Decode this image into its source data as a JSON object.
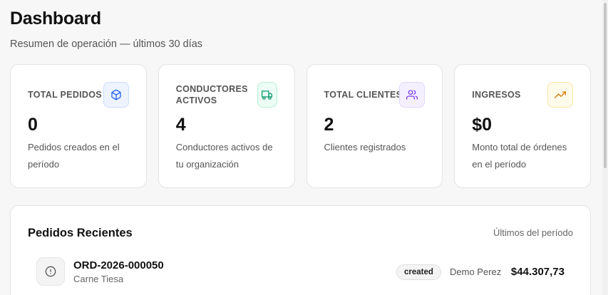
{
  "header": {
    "title": "Dashboard",
    "subtitle": "Resumen de operación — últimos 30 días"
  },
  "stats": [
    {
      "label": "Total pedidos",
      "value": "0",
      "description": "Pedidos creados en el período",
      "icon": "box-icon",
      "color": "#2563eb"
    },
    {
      "label": "Conductores activos",
      "value": "4",
      "description": "Conductores activos de tu organización",
      "icon": "truck-icon",
      "color": "#059669"
    },
    {
      "label": "Total clientes",
      "value": "2",
      "description": "Clientes registrados",
      "icon": "users-icon",
      "color": "#7c3aed"
    },
    {
      "label": "Ingresos",
      "value": "$0",
      "description": "Monto total de órdenes en el período",
      "icon": "trending-up-icon",
      "color": "#d97706"
    }
  ],
  "recent_orders": {
    "title": "Pedidos Recientes",
    "period": "Últimos del período",
    "orders": [
      {
        "id": "ORD-2026-000050",
        "product": "Carne Tiesa",
        "status": "created",
        "customer": "Demo Perez",
        "amount": "$44.307,73",
        "icon": "alert-circle-icon"
      }
    ]
  }
}
